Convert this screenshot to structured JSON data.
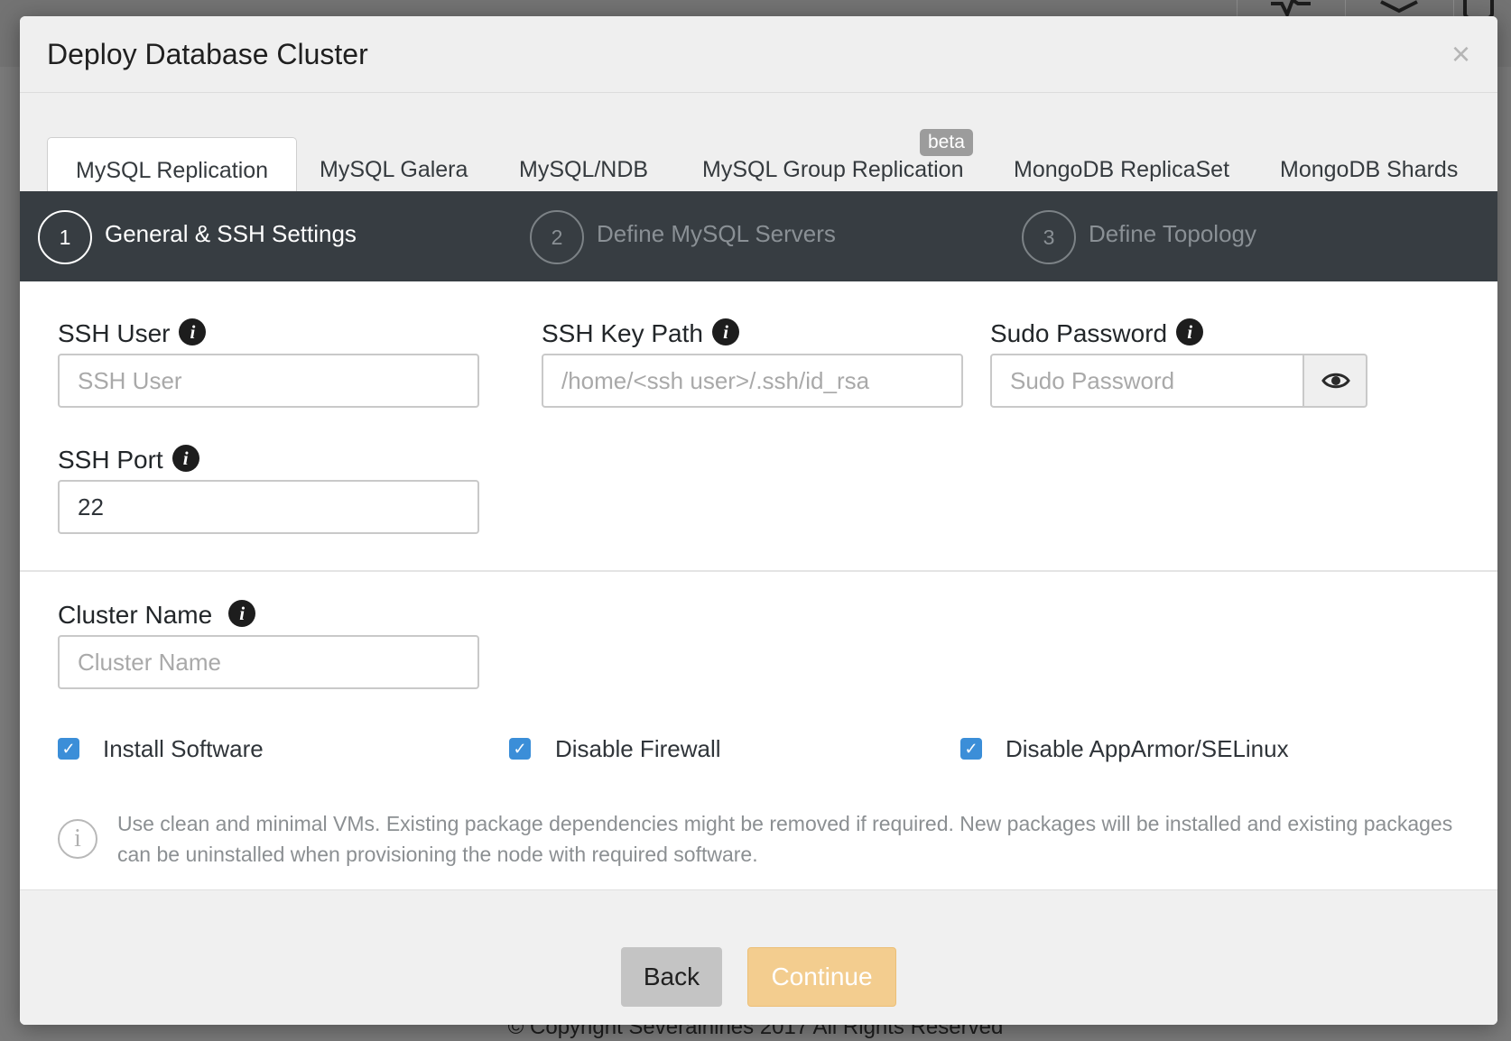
{
  "background": {
    "footer_text": "© Copyright Severalnines 2017 All Rights Reserved",
    "icons": [
      "activity-icon",
      "layers-icon",
      "camera-icon"
    ]
  },
  "modal": {
    "title": "Deploy Database Cluster",
    "close_glyph": "×",
    "tabs": [
      {
        "label": "MySQL Replication",
        "active": true
      },
      {
        "label": "MySQL Galera",
        "active": false
      },
      {
        "label": "MySQL/NDB",
        "active": false
      },
      {
        "label": "MySQL Group Replication",
        "active": false,
        "badge": "beta"
      },
      {
        "label": "MongoDB ReplicaSet",
        "active": false
      },
      {
        "label": "MongoDB Shards",
        "active": false
      }
    ],
    "steps": [
      {
        "number": "1",
        "label": "General & SSH Settings",
        "active": true
      },
      {
        "number": "2",
        "label": "Define MySQL Servers",
        "active": false
      },
      {
        "number": "3",
        "label": "Define Topology",
        "active": false
      }
    ],
    "fields": {
      "ssh_user": {
        "label": "SSH User",
        "placeholder": "SSH User",
        "value": ""
      },
      "ssh_key_path": {
        "label": "SSH Key Path",
        "placeholder": "/home/<ssh user>/.ssh/id_rsa",
        "value": ""
      },
      "sudo_password": {
        "label": "Sudo Password",
        "placeholder": "Sudo Password",
        "value": ""
      },
      "ssh_port": {
        "label": "SSH Port",
        "placeholder": "",
        "value": "22"
      },
      "cluster_name": {
        "label": "Cluster Name",
        "placeholder": "Cluster Name",
        "value": ""
      }
    },
    "info_glyph": "i",
    "checkboxes": [
      {
        "label": "Install Software",
        "checked": true
      },
      {
        "label": "Disable Firewall",
        "checked": true
      },
      {
        "label": "Disable AppArmor/SELinux",
        "checked": true
      }
    ],
    "check_glyph": "✓",
    "note": "Use clean and minimal VMs. Existing package dependencies might be removed if required. New packages will be installed and existing packages can be uninstalled when provisioning the node with required software.",
    "buttons": {
      "back": "Back",
      "continue": "Continue"
    },
    "colors": {
      "accent": "#3b8ed8",
      "steps_bar": "#373d42",
      "continue_button": "#f3cd8f"
    }
  }
}
